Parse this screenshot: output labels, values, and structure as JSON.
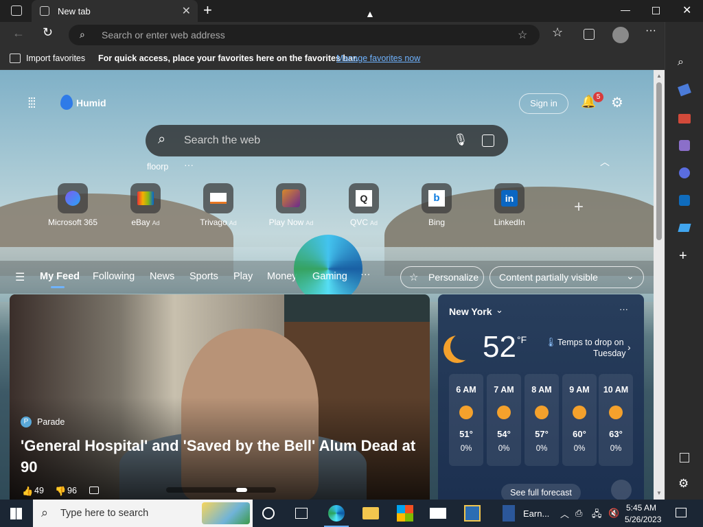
{
  "browser": {
    "tab_title": "New tab",
    "address_placeholder": "Search or enter web address"
  },
  "favorites_bar": {
    "import_label": "Import favorites",
    "message": "For quick access, place your favorites here on the favorites bar.",
    "manage_link": "Manage favorites now"
  },
  "newtab": {
    "weather_brand": "Humid",
    "sign_in": "Sign in",
    "notification_count": "5",
    "search_placeholder": "Search the web",
    "recent_search": "floorp",
    "more": "···",
    "shortcuts": [
      {
        "name": "Microsoft 365",
        "ad": ""
      },
      {
        "name": "eBay",
        "ad": "Ad"
      },
      {
        "name": "Trivago",
        "ad": "Ad"
      },
      {
        "name": "Play Now",
        "ad": "Ad"
      },
      {
        "name": "QVC",
        "ad": "Ad"
      },
      {
        "name": "Bing",
        "ad": ""
      },
      {
        "name": "LinkedIn",
        "ad": ""
      }
    ],
    "feed_tabs": [
      "My Feed",
      "Following",
      "News",
      "Sports",
      "Play",
      "Money",
      "Gaming"
    ],
    "feed_more": "···",
    "personalize": "Personalize",
    "content_visibility": "Content partially visible"
  },
  "hero": {
    "source": "Parade",
    "headline": "'General Hospital' and 'Saved by the Bell' Alum Dead at 90",
    "likes": "49",
    "dislikes": "96"
  },
  "weather": {
    "location": "New York",
    "temp": "52",
    "unit": "°F",
    "alert_line1": "Temps to drop on",
    "alert_line2": "Tuesday",
    "hours": [
      {
        "time": "6 AM",
        "temp": "51°",
        "precip": "0%"
      },
      {
        "time": "7 AM",
        "temp": "54°",
        "precip": "0%"
      },
      {
        "time": "8 AM",
        "temp": "57°",
        "precip": "0%"
      },
      {
        "time": "9 AM",
        "temp": "60°",
        "precip": "0%"
      },
      {
        "time": "10 AM",
        "temp": "63°",
        "precip": "0%"
      }
    ],
    "full_forecast": "See full forecast"
  },
  "taskbar": {
    "search_placeholder": "Type here to search",
    "app_label": "Earn...",
    "time": "5:45 AM",
    "date": "5/26/2023"
  }
}
